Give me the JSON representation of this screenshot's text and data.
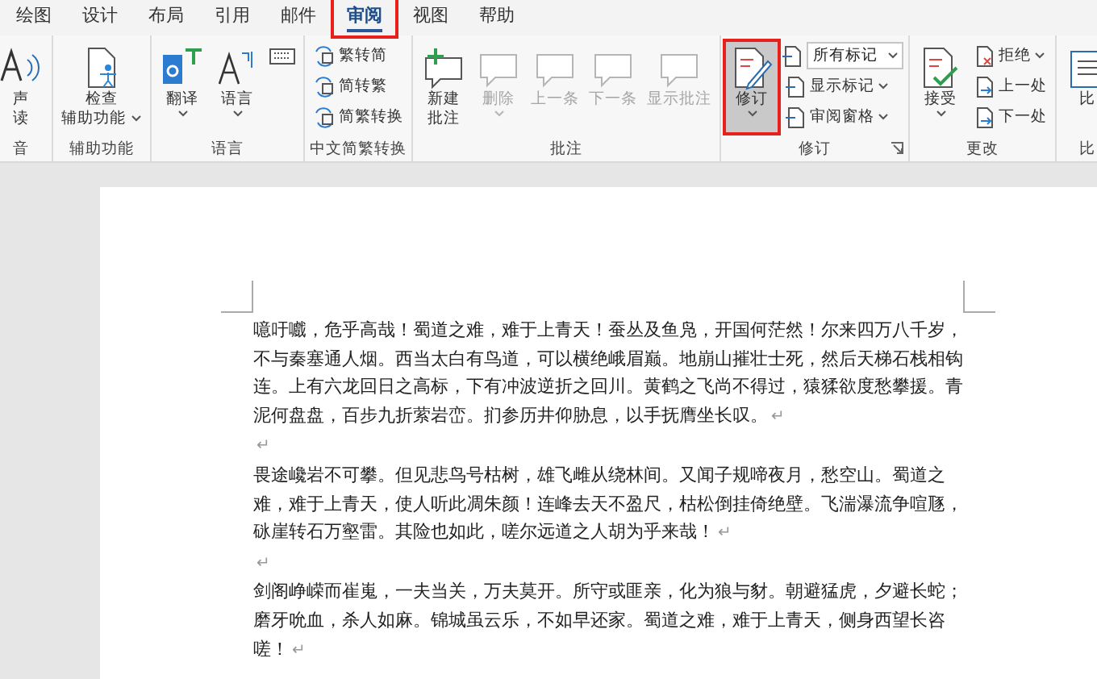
{
  "tabs": [
    {
      "label": "绘图",
      "selected": false,
      "annotated": false
    },
    {
      "label": "设计",
      "selected": false,
      "annotated": false
    },
    {
      "label": "布局",
      "selected": false,
      "annotated": false
    },
    {
      "label": "引用",
      "selected": false,
      "annotated": false
    },
    {
      "label": "邮件",
      "selected": false,
      "annotated": false
    },
    {
      "label": "审阅",
      "selected": true,
      "annotated": true
    },
    {
      "label": "视图",
      "selected": false,
      "annotated": false
    },
    {
      "label": "帮助",
      "selected": false,
      "annotated": false
    }
  ],
  "ribbon": {
    "groups": [
      {
        "label": "音",
        "launcher": false,
        "items": [
          {
            "kind": "large",
            "lines": [
              "声",
              "读"
            ],
            "dropdown": false,
            "disabled": false,
            "selected": false,
            "annotated": false
          }
        ]
      },
      {
        "label": "辅助功能",
        "launcher": false,
        "items": [
          {
            "kind": "large",
            "lines": [
              "检查",
              "辅助功能"
            ],
            "dropdown": true,
            "disabled": false,
            "selected": false,
            "annotated": false
          }
        ]
      },
      {
        "label": "语言",
        "launcher": false,
        "items": [
          {
            "kind": "large",
            "lines": [
              "翻译"
            ],
            "dropdown": true,
            "disabled": false,
            "selected": false,
            "annotated": false
          },
          {
            "kind": "large",
            "lines": [
              "语言"
            ],
            "dropdown": true,
            "disabled": false,
            "selected": false,
            "annotated": false
          },
          {
            "kind": "icon"
          }
        ]
      },
      {
        "label": "中文简繁转换",
        "launcher": false,
        "items": [
          {
            "kind": "stack",
            "items": [
              {
                "kind": "small",
                "text": "繁转简",
                "dropdown": false,
                "disabled": false
              },
              {
                "kind": "small",
                "text": "简转繁",
                "dropdown": false,
                "disabled": false
              },
              {
                "kind": "small",
                "text": "简繁转换",
                "dropdown": false,
                "disabled": false
              }
            ]
          }
        ]
      },
      {
        "label": "批注",
        "launcher": false,
        "items": [
          {
            "kind": "large",
            "lines": [
              "新建",
              "批注"
            ],
            "dropdown": false,
            "disabled": false,
            "selected": false,
            "annotated": false
          },
          {
            "kind": "large",
            "lines": [
              "删除"
            ],
            "dropdown": true,
            "disabled": true,
            "selected": false,
            "annotated": false
          },
          {
            "kind": "large",
            "lines": [
              "上一条"
            ],
            "dropdown": false,
            "disabled": true,
            "selected": false,
            "annotated": false
          },
          {
            "kind": "large",
            "lines": [
              "下一条"
            ],
            "dropdown": false,
            "disabled": true,
            "selected": false,
            "annotated": false
          },
          {
            "kind": "large",
            "lines": [
              "显示批注"
            ],
            "dropdown": false,
            "disabled": true,
            "selected": false,
            "annotated": false
          }
        ]
      },
      {
        "label": "修订",
        "launcher": true,
        "items": [
          {
            "kind": "large",
            "lines": [
              "修订"
            ],
            "dropdown": true,
            "disabled": false,
            "selected": true,
            "annotated": true
          },
          {
            "kind": "stack",
            "items": [
              {
                "kind": "combo",
                "value": "所有标记",
                "dropdown": true
              },
              {
                "kind": "small",
                "text": "显示标记",
                "dropdown": true,
                "disabled": false
              },
              {
                "kind": "small",
                "text": "审阅窗格",
                "dropdown": true,
                "disabled": false
              }
            ]
          }
        ]
      },
      {
        "label": "更改",
        "launcher": false,
        "items": [
          {
            "kind": "large",
            "lines": [
              "接受"
            ],
            "dropdown": true,
            "disabled": false,
            "selected": false,
            "annotated": false
          },
          {
            "kind": "stack",
            "items": [
              {
                "kind": "small",
                "text": "拒绝",
                "dropdown": true,
                "disabled": false
              },
              {
                "kind": "small",
                "text": "上一处",
                "dropdown": false,
                "disabled": false
              },
              {
                "kind": "small",
                "text": "下一处",
                "dropdown": false,
                "disabled": false
              }
            ]
          }
        ]
      },
      {
        "label": "比",
        "launcher": false,
        "items": [
          {
            "kind": "large",
            "lines": [
              "比"
            ],
            "dropdown": false,
            "disabled": false,
            "selected": false,
            "annotated": false
          }
        ]
      }
    ]
  },
  "document": {
    "paragraphs": [
      {
        "kind": "text",
        "text": "噫吁嚱，危乎高哉！蜀道之难，难于上青天！蚕丛及鱼凫，开国何茫然！尔来四万八千岁，不与秦塞通人烟。西当太白有鸟道，可以横绝峨眉巅。地崩山摧壮士死，然后天梯石栈相钩连。上有六龙回日之高标，下有冲波逆折之回川。黄鹤之飞尚不得过，猿猱欲度愁攀援。青泥何盘盘，百步九折萦岩峦。扪参历井仰胁息，以手抚膺坐长叹。",
        "mark": "↵"
      },
      {
        "kind": "blank",
        "mark": "↵"
      },
      {
        "kind": "text",
        "text": "畏途巉岩不可攀。但见悲鸟号枯树，雄飞雌从绕林间。又闻子规啼夜月，愁空山。蜀道之难，难于上青天，使人听此凋朱颜！连峰去天不盈尺，枯松倒挂倚绝壁。飞湍瀑流争喧豗，砯崖转石万壑雷。其险也如此，嗟尔远道之人胡为乎来哉！",
        "mark": "↵"
      },
      {
        "kind": "blank",
        "mark": "↵"
      },
      {
        "kind": "text",
        "text": "剑阁峥嵘而崔嵬，一夫当关，万夫莫开。所守或匪亲，化为狼与豺。朝避猛虎，夕避长蛇；磨牙吮血，杀人如麻。锦城虽云乐，不如早还家。蜀道之难，难于上青天，侧身西望长咨嗟！",
        "mark": "↵"
      }
    ]
  }
}
